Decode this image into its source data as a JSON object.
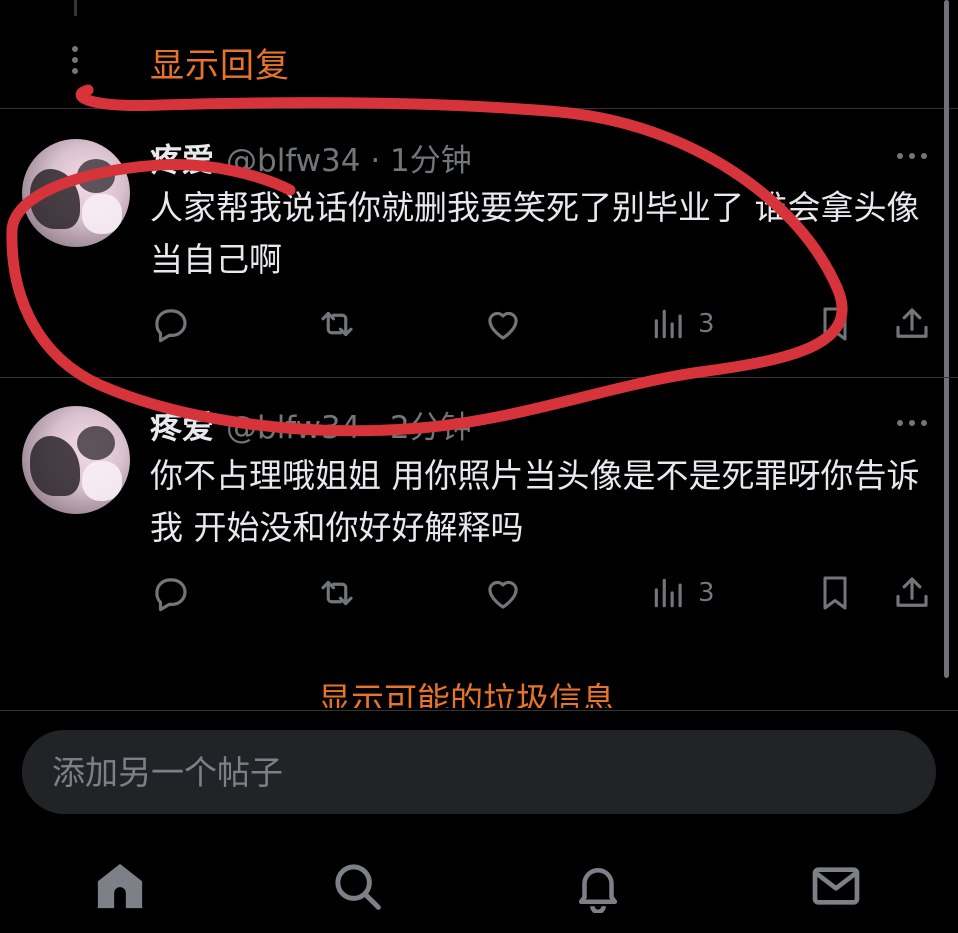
{
  "thread": {
    "show_replies_label": "显示回复",
    "show_spam_label": "显示可能的垃圾信息"
  },
  "posts": [
    {
      "author": "疼爱",
      "handle_time": "@blfw34 · 1分钟",
      "text": "人家帮我说话你就删我要笑死了别毕业了 谁会拿头像当自己啊",
      "views": "3"
    },
    {
      "author": "疼爱",
      "handle_time": "@blfw34 · 2分钟",
      "text": "你不占理哦姐姐 用你照片当头像是不是死罪呀你告诉我 开始没和你好好解释吗",
      "views": "3"
    }
  ],
  "compose": {
    "placeholder": "添加另一个帖子"
  },
  "icons": {
    "reply": "reply-icon",
    "repost": "repost-icon",
    "like": "like-icon",
    "views": "views-icon",
    "bookmark": "bookmark-icon",
    "share": "share-icon",
    "home": "home-icon",
    "search": "search-icon",
    "notifications": "bell-icon",
    "messages": "mail-icon"
  },
  "colors": {
    "accent": "#e8742a",
    "annotation": "#d6333b",
    "muted": "#71767b",
    "compose_bg": "#212327"
  }
}
